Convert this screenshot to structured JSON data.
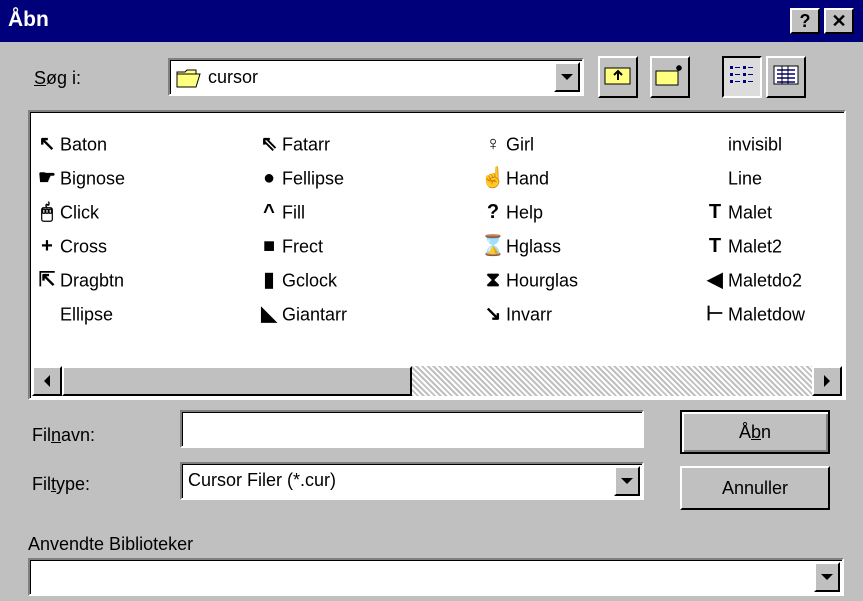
{
  "window": {
    "title": "Åbn",
    "help_label": "?",
    "close_label": "✕"
  },
  "lookin": {
    "label_prefix": "S",
    "label_u": "ø",
    "label_suffix": "g i:",
    "folder_name": "cursor"
  },
  "toolbar": {
    "up_icon": "folder-up-icon",
    "new_folder_icon": "new-folder-icon",
    "list_icon": "list-view-icon",
    "details_icon": "details-view-icon"
  },
  "files": {
    "col1": [
      {
        "name": "Baton",
        "icon": "↖"
      },
      {
        "name": "Bignose",
        "icon": "☛"
      },
      {
        "name": "Click",
        "icon": "🖱"
      },
      {
        "name": "Cross",
        "icon": "+"
      },
      {
        "name": "Dragbtn",
        "icon": "⇱"
      },
      {
        "name": "Ellipse",
        "icon": ""
      }
    ],
    "col2": [
      {
        "name": "Fatarr",
        "icon": "⇖"
      },
      {
        "name": "Fellipse",
        "icon": "●"
      },
      {
        "name": "Fill",
        "icon": "^"
      },
      {
        "name": "Frect",
        "icon": "■"
      },
      {
        "name": "Gclock",
        "icon": "▮"
      },
      {
        "name": "Giantarr",
        "icon": "◣"
      }
    ],
    "col3": [
      {
        "name": "Girl",
        "icon": "♀"
      },
      {
        "name": "Hand",
        "icon": "☝"
      },
      {
        "name": "Help",
        "icon": "?"
      },
      {
        "name": "Hglass",
        "icon": "⌛"
      },
      {
        "name": "Hourglas",
        "icon": "⧗"
      },
      {
        "name": "Invarr",
        "icon": "↘"
      }
    ],
    "col4": [
      {
        "name": "invisibl",
        "icon": ""
      },
      {
        "name": "Line",
        "icon": ""
      },
      {
        "name": "Malet",
        "icon": "T"
      },
      {
        "name": "Malet2",
        "icon": "T"
      },
      {
        "name": "Maletdo2",
        "icon": "◀"
      },
      {
        "name": "Maletdow",
        "icon": "⊢"
      }
    ]
  },
  "filename": {
    "label_prefix": "Fil",
    "label_u": "n",
    "label_suffix": "avn:",
    "value": ""
  },
  "filetype": {
    "label_prefix": "Fil",
    "label_u": "t",
    "label_suffix": "ype:",
    "value": "Cursor Filer (*.cur)"
  },
  "buttons": {
    "open_prefix": "Å",
    "open_u": "b",
    "open_suffix": "n",
    "cancel": "Annuller"
  },
  "libraries": {
    "label": "Anvendte Biblioteker",
    "value": ""
  }
}
